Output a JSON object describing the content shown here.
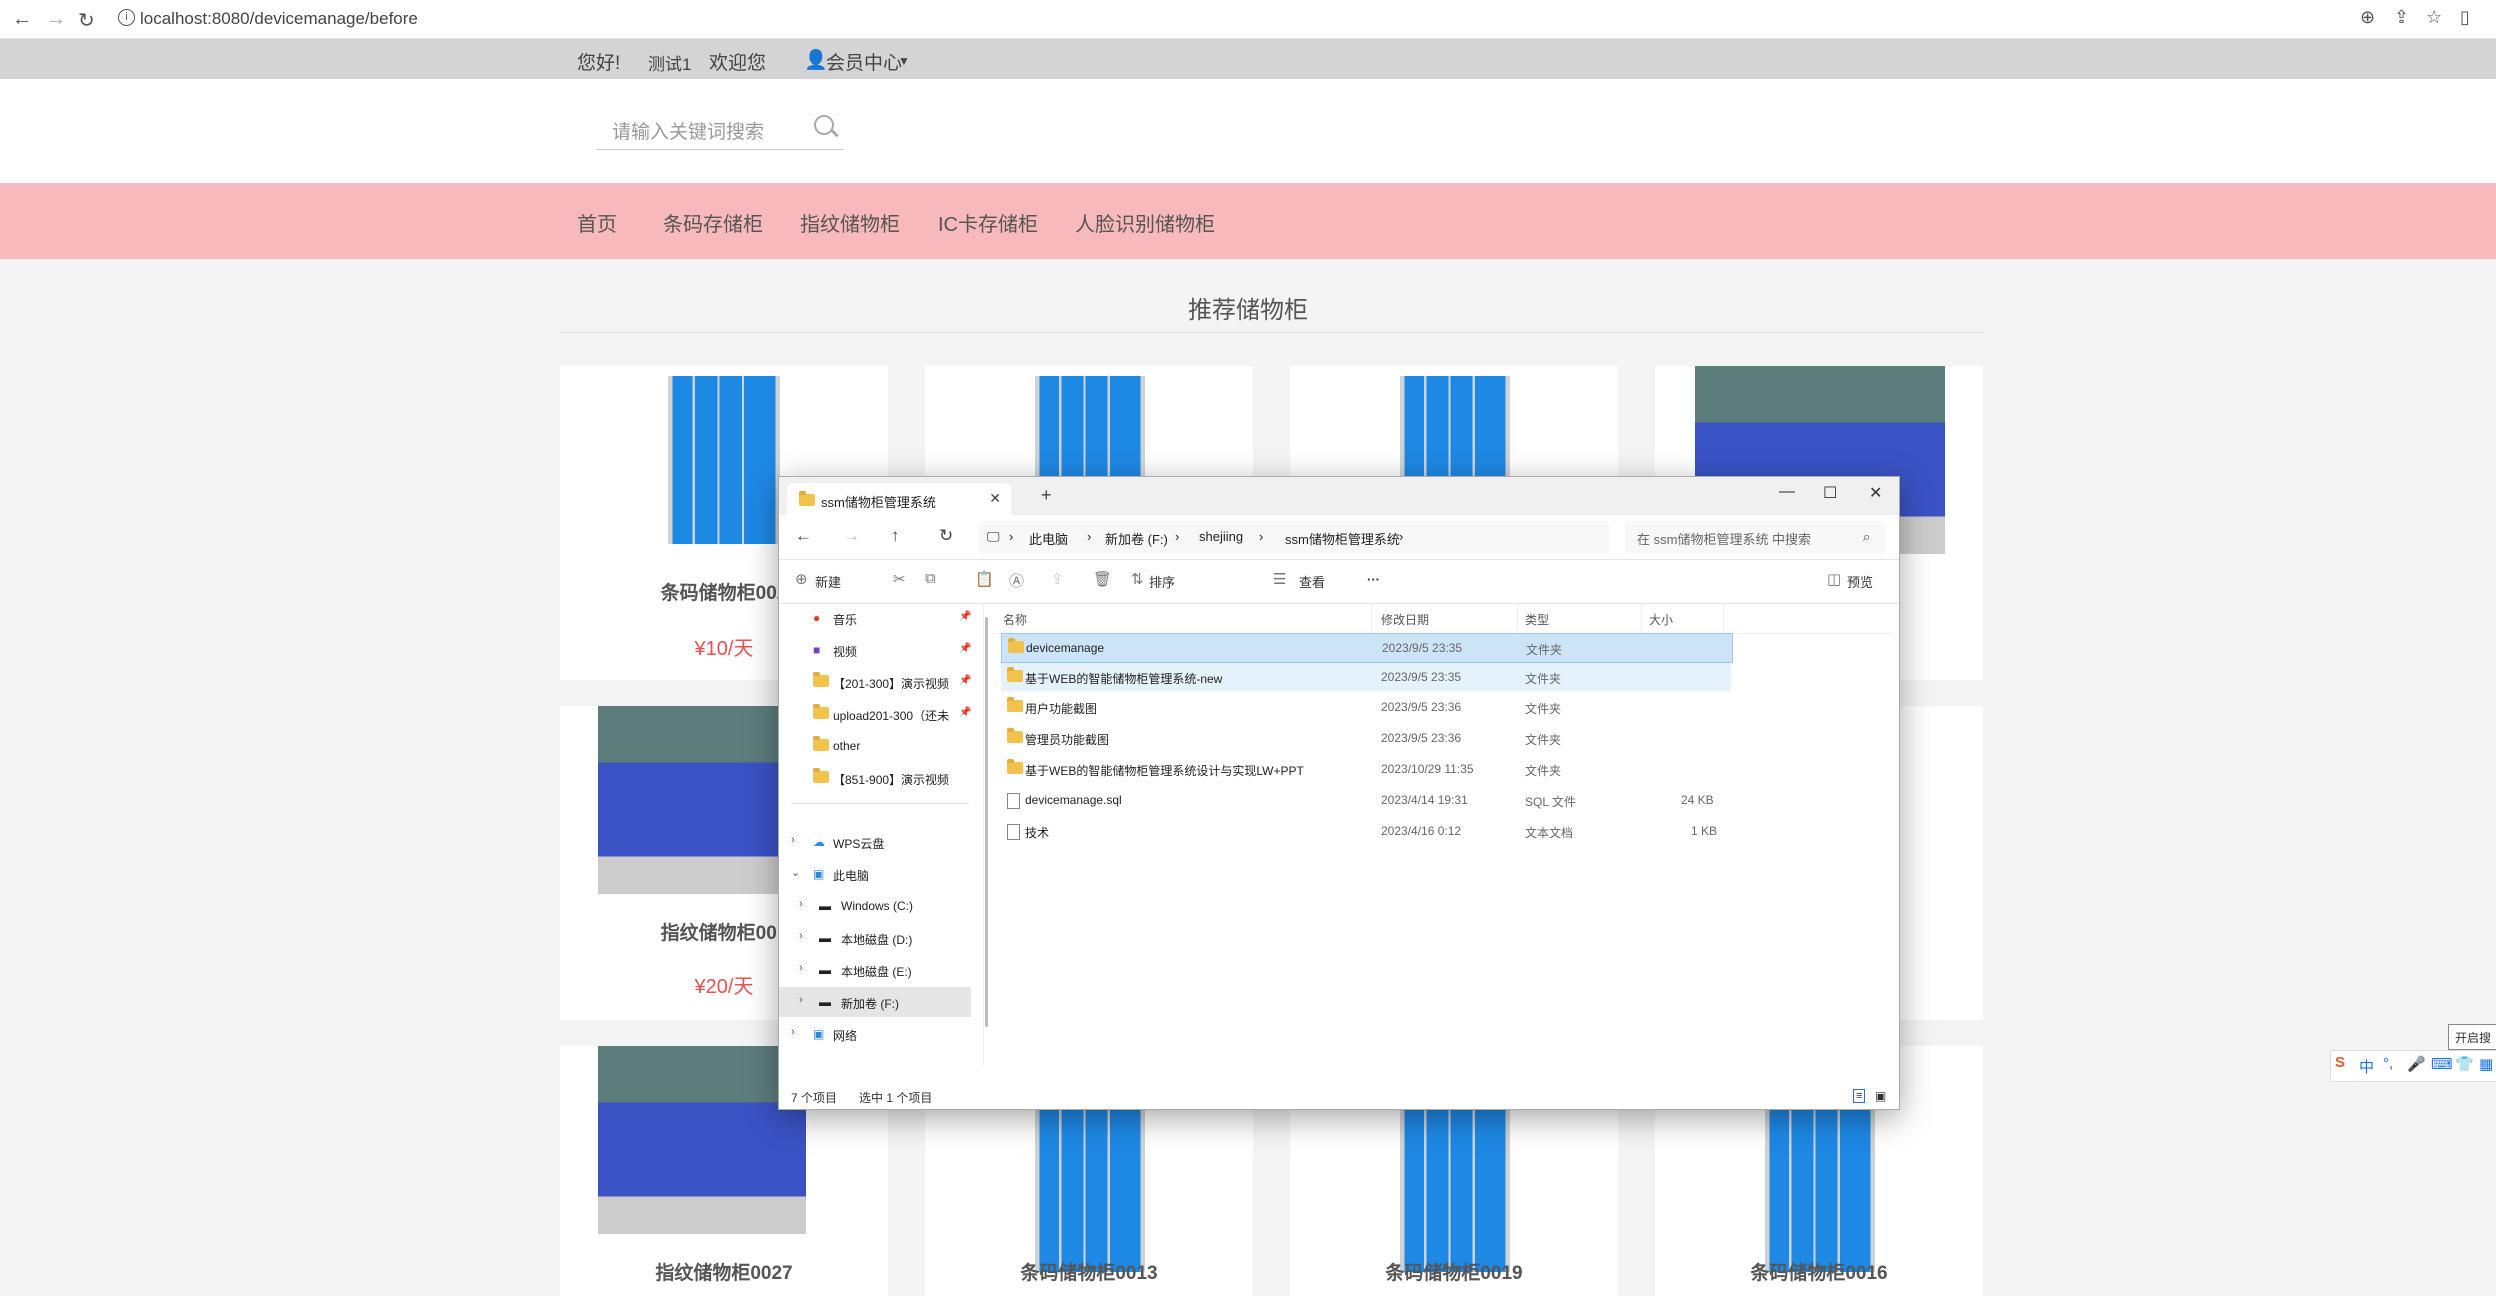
{
  "browser": {
    "url": "localhost:8080/devicemanage/before"
  },
  "topbar": {
    "greeting": "您好!",
    "username": "测试1",
    "welcome": "欢迎您",
    "member_center": "会员中心"
  },
  "search": {
    "placeholder": "请输入关键词搜索"
  },
  "nav": [
    "首页",
    "条码存储柜",
    "指纹储物柜",
    "IC卡存储柜",
    "人脸识别储物柜"
  ],
  "section_title": "推荐储物柜",
  "cards": [
    {
      "name": "条码储物柜002",
      "price": "¥10/天"
    },
    {
      "name": "指纹储物柜001",
      "price": "¥20/天"
    },
    {
      "name": "指纹储物柜0027",
      "price": ""
    },
    {
      "name": "条码储物柜0013",
      "price": ""
    },
    {
      "name": "条码储物柜0019",
      "price": ""
    },
    {
      "name": "条码储物柜0016",
      "price": ""
    }
  ],
  "explorer": {
    "tab_title": "ssm储物柜管理系统",
    "breadcrumbs": [
      "此电脑",
      "新加卷 (F:)",
      "shejiing",
      "ssm储物柜管理系统"
    ],
    "search_placeholder": "在 ssm储物柜管理系统 中搜索",
    "toolbar": {
      "new": "新建",
      "sort": "排序",
      "view": "查看",
      "more": "···",
      "preview": "预览"
    },
    "sidebar": [
      {
        "label": "音乐",
        "icon": "music-icon",
        "pinned": true
      },
      {
        "label": "视频",
        "icon": "video-icon",
        "pinned": true
      },
      {
        "label": "【201-300】演示视频",
        "icon": "folder-icon",
        "pinned": true
      },
      {
        "label": "upload201-300（还未",
        "icon": "folder-icon",
        "pinned": true
      },
      {
        "label": "other",
        "icon": "folder-icon",
        "pinned": false
      },
      {
        "label": "【851-900】演示视频",
        "icon": "folder-icon",
        "pinned": false
      },
      {
        "label": "WPS云盘",
        "icon": "cloud-icon",
        "pinned": false
      },
      {
        "label": "此电脑",
        "icon": "computer-icon",
        "pinned": false
      },
      {
        "label": "Windows (C:)",
        "icon": "drive-icon",
        "pinned": false
      },
      {
        "label": "本地磁盘 (D:)",
        "icon": "drive-icon",
        "pinned": false
      },
      {
        "label": "本地磁盘 (E:)",
        "icon": "drive-icon",
        "pinned": false
      },
      {
        "label": "新加卷 (F:)",
        "icon": "drive-icon",
        "pinned": false
      },
      {
        "label": "网络",
        "icon": "network-icon",
        "pinned": false
      }
    ],
    "columns": [
      "名称",
      "修改日期",
      "类型",
      "大小"
    ],
    "files": [
      {
        "name": "devicemanage",
        "date": "2023/9/5 23:35",
        "type": "文件夹",
        "size": ""
      },
      {
        "name": "基于WEB的智能储物柜管理系统-new",
        "date": "2023/9/5 23:35",
        "type": "文件夹",
        "size": ""
      },
      {
        "name": "用户功能截图",
        "date": "2023/9/5 23:36",
        "type": "文件夹",
        "size": ""
      },
      {
        "name": "管理员功能截图",
        "date": "2023/9/5 23:36",
        "type": "文件夹",
        "size": ""
      },
      {
        "name": "基于WEB的智能储物柜管理系统设计与实现LW+PPT",
        "date": "2023/10/29 11:35",
        "type": "文件夹",
        "size": ""
      },
      {
        "name": "devicemanage.sql",
        "date": "2023/4/14 19:31",
        "type": "SQL 文件",
        "size": "24 KB"
      },
      {
        "name": "技术",
        "date": "2023/4/16 0:12",
        "type": "文本文档",
        "size": "1 KB"
      }
    ],
    "status": {
      "count": "7 个项目",
      "selected": "选中 1 个项目"
    }
  },
  "ime": {
    "tooltip": "开启搜",
    "label": "中"
  }
}
